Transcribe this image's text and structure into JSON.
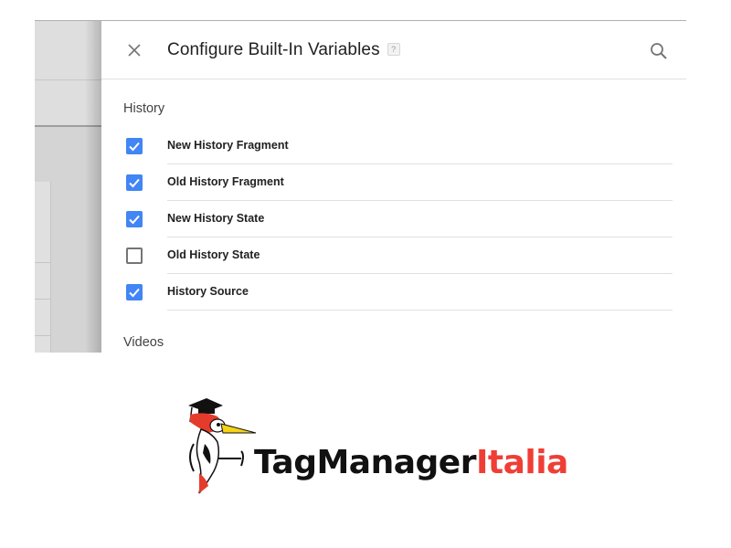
{
  "dialog": {
    "title": "Configure Built-In Variables",
    "help_label": "?",
    "close_icon": "close-icon",
    "search_icon": "search-icon"
  },
  "sections": [
    {
      "title": "History",
      "items": [
        {
          "label": "New History Fragment",
          "checked": true
        },
        {
          "label": "Old History Fragment",
          "checked": true
        },
        {
          "label": "New History State",
          "checked": true
        },
        {
          "label": "Old History State",
          "checked": false
        },
        {
          "label": "History Source",
          "checked": true
        }
      ]
    },
    {
      "title": "Videos",
      "items": []
    }
  ],
  "colors": {
    "checkbox_checked": "#4285f4",
    "checkbox_unchecked_border": "#757575",
    "logo_dark": "#111111",
    "logo_accent": "#ef3e36"
  },
  "logo": {
    "text_part1": "TagManager",
    "text_part2": "Italia",
    "mascot": "woodpecker-graduate-icon"
  }
}
